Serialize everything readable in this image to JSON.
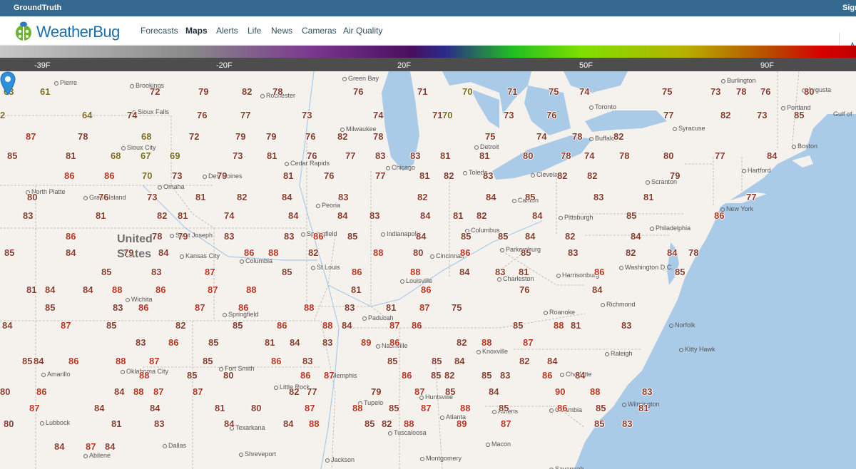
{
  "topbar": {
    "brand": "GroundTruth",
    "signin": "Sign"
  },
  "logo": {
    "word": "WeatherBug"
  },
  "nav": {
    "items": [
      {
        "label": "Forecasts",
        "active": false
      },
      {
        "label": "Maps",
        "active": true
      },
      {
        "label": "Alerts",
        "active": false
      },
      {
        "label": "Life",
        "active": false
      },
      {
        "label": "News",
        "active": false
      },
      {
        "label": "Cameras",
        "active": false
      },
      {
        "label": "Air Quality",
        "active": false
      }
    ]
  },
  "legend": {
    "ticks": [
      "-39F",
      "-20F",
      "20F",
      "50F",
      "90F"
    ]
  },
  "map": {
    "country_label": "United States",
    "cities": [
      "Pierre",
      "Brookings",
      "Sioux Falls",
      "Sioux City",
      "Omaha",
      "North Platte",
      "Grand Island",
      "Des Moines",
      "Cedar Rapids",
      "Rochester",
      "Milwaukee",
      "Green Bay",
      "Chicago",
      "Peoria",
      "Springfield",
      "Indianapolis",
      "Saint Joseph",
      "Kansas City",
      "Columbia",
      "St Louis",
      "Wichita",
      "Springfield",
      "Paducah",
      "Louisville",
      "Cincinnati",
      "Columbus",
      "Toledo",
      "Detroit",
      "Cleveland",
      "Canton",
      "Pittsburgh",
      "Parkersburg",
      "Charleston",
      "Harrisonburg",
      "Roanoke",
      "Richmond",
      "Washington D.C.",
      "Philadelphia",
      "New York",
      "Hartford",
      "Boston",
      "Portland",
      "Augusta",
      "Burlington",
      "Syracuse",
      "Buffalo",
      "Toronto",
      "Scranton",
      "Norfolk",
      "Kitty Hawk",
      "Raleigh",
      "Charlotte",
      "Knoxville",
      "Nashville",
      "Memphis",
      "Huntsville",
      "Tupelo",
      "Atlanta",
      "Athens",
      "Columbia",
      "Wilmington",
      "Tuscaloosa",
      "Macon",
      "Montgomery",
      "Savannah",
      "Jackson",
      "Shreveport",
      "Texarkana",
      "Little Rock",
      "Fort Smith",
      "Oklahoma City",
      "Amarillo",
      "Lubbock",
      "Abilene",
      "Dallas",
      "Gulf of"
    ],
    "temps": [
      "60",
      "64",
      "65",
      "66",
      "79",
      "81",
      "72",
      "73",
      "76",
      "77",
      "72",
      "75",
      "77",
      "72",
      "63",
      "61",
      "72",
      "79",
      "82",
      "78",
      "76",
      "71",
      "70",
      "71",
      "75",
      "74",
      "75",
      "73",
      "78",
      "76",
      "80",
      "2",
      "64",
      "74",
      "76",
      "77",
      "73",
      "74",
      "71",
      "70",
      "73",
      "76",
      "77",
      "82",
      "73",
      "85",
      "87",
      "78",
      "68",
      "72",
      "79",
      "79",
      "76",
      "82",
      "78",
      "75",
      "74",
      "78",
      "82",
      "85",
      "81",
      "68",
      "67",
      "69",
      "73",
      "81",
      "76",
      "77",
      "83",
      "83",
      "81",
      "81",
      "80",
      "78",
      "74",
      "78",
      "80",
      "77",
      "84",
      "86",
      "86",
      "70",
      "73",
      "79",
      "81",
      "76",
      "77",
      "81",
      "82",
      "83",
      "82",
      "82",
      "79",
      "80",
      "76",
      "73",
      "81",
      "82",
      "84",
      "83",
      "82",
      "84",
      "85",
      "83",
      "81",
      "77",
      "83",
      "81",
      "82",
      "81",
      "74",
      "84",
      "84",
      "83",
      "84",
      "81",
      "82",
      "84",
      "85",
      "86",
      "86",
      "78",
      "79",
      "83",
      "83",
      "86",
      "85",
      "84",
      "85",
      "85",
      "84",
      "82",
      "84",
      "85",
      "84",
      "79",
      "84",
      "86",
      "88",
      "82",
      "88",
      "80",
      "86",
      "85",
      "83",
      "82",
      "84",
      "78",
      "85",
      "83",
      "87",
      "85",
      "86",
      "88",
      "84",
      "83",
      "81",
      "86",
      "85",
      "81",
      "84",
      "84",
      "88",
      "86",
      "87",
      "88",
      "81",
      "86",
      "76",
      "84",
      "85",
      "83",
      "86",
      "87",
      "86",
      "88",
      "83",
      "81",
      "87",
      "75",
      "84",
      "87",
      "85",
      "82",
      "85",
      "86",
      "88",
      "84",
      "87",
      "86",
      "85",
      "88",
      "81",
      "83",
      "83",
      "86",
      "85",
      "81",
      "84",
      "83",
      "89",
      "86",
      "82",
      "88",
      "87",
      "85",
      "84",
      "86",
      "88",
      "87",
      "85",
      "86",
      "83",
      "85",
      "85",
      "84",
      "82",
      "84",
      "88",
      "85",
      "80",
      "86",
      "87",
      "86",
      "85",
      "82",
      "85",
      "83",
      "86",
      "84",
      "80",
      "86",
      "84",
      "88",
      "87",
      "87",
      "82",
      "77",
      "79",
      "87",
      "85",
      "84",
      "90",
      "88",
      "83",
      "87",
      "84",
      "84",
      "81",
      "80",
      "87",
      "88",
      "85",
      "87",
      "88",
      "85",
      "86",
      "85",
      "81",
      "80",
      "81",
      "83",
      "84",
      "84",
      "88",
      "85",
      "82",
      "88",
      "89",
      "87",
      "85",
      "83",
      "84",
      "87",
      "84"
    ],
    "pin_icon": "location-pin-icon"
  }
}
